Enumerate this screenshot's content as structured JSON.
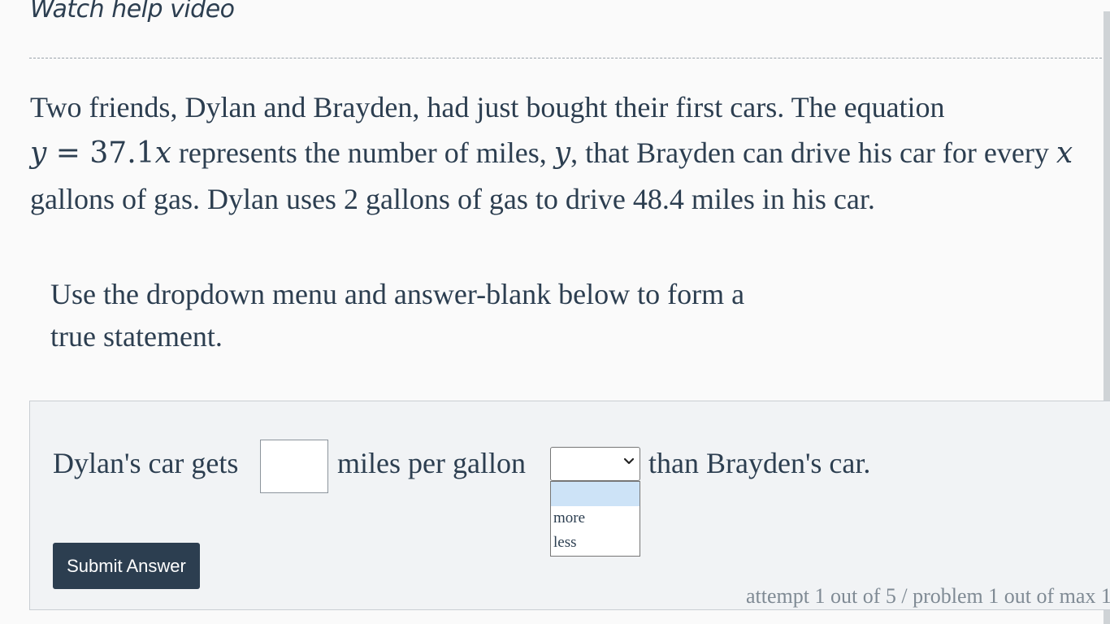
{
  "help": {
    "link_text": "Watch help video"
  },
  "problem": {
    "part1": "Two friends, Dylan and Brayden, had just bought their first cars. The equation",
    "eq_y": "y",
    "eq_eq": " = ",
    "eq_coef": "37.1",
    "eq_x": "x",
    "part2": " represents the number of miles, ",
    "var_y": "y",
    "part3": ", that Brayden can drive his car for every ",
    "var_x": "x",
    "part4": " gallons of gas. Dylan uses 2 gallons of gas to drive 48.4 miles in his car."
  },
  "instructions": {
    "line1": "Use the dropdown menu and answer-blank below to form a",
    "line2": "true statement."
  },
  "statement": {
    "before_blank": "Dylan's car gets",
    "after_blank": "miles per gallon",
    "after_dropdown": "than Brayden's car."
  },
  "answer_blank": {
    "value": ""
  },
  "dropdown": {
    "selected": "",
    "options": [
      "",
      "more",
      "less"
    ]
  },
  "submit": {
    "label": "Submit Answer"
  },
  "status": {
    "attempt_text": "attempt 1 out of 5 / problem 1 out of max 1"
  }
}
